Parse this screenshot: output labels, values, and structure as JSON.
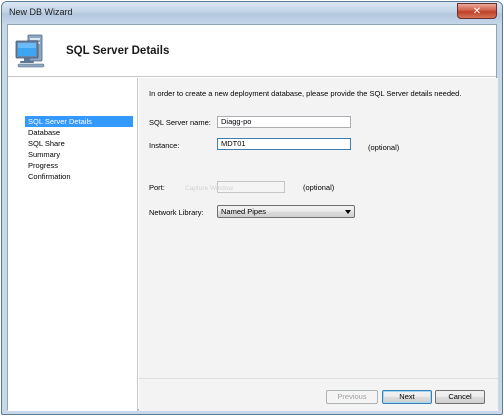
{
  "window": {
    "title": "New DB Wizard",
    "close_glyph": "✕"
  },
  "header": {
    "title": "SQL Server Details",
    "icon": "computer-icon"
  },
  "sidebar": {
    "items": [
      {
        "label": "SQL Server Details",
        "selected": true
      },
      {
        "label": "Database",
        "selected": false
      },
      {
        "label": "SQL Share",
        "selected": false
      },
      {
        "label": "Summary",
        "selected": false
      },
      {
        "label": "Progress",
        "selected": false
      },
      {
        "label": "Confirmation",
        "selected": false
      }
    ]
  },
  "form": {
    "intro": "In order to create a new deployment database, please provide the SQL Server details needed.",
    "server_name": {
      "label": "SQL Server name:",
      "value": "Diagg-po"
    },
    "instance": {
      "label": "Instance:",
      "value": "MDT01",
      "hint": "(optional)"
    },
    "port": {
      "label": "Port:",
      "value": "",
      "ghost_text": "Capture Window",
      "hint": "(optional)"
    },
    "network_library": {
      "label": "Network Library:",
      "selected": "Named Pipes"
    }
  },
  "buttons": {
    "previous": "Previous",
    "next": "Next",
    "cancel": "Cancel"
  },
  "colors": {
    "selection": "#3399ff",
    "content_bg": "#f3f3f3",
    "accent_border": "#3c7fb1"
  }
}
